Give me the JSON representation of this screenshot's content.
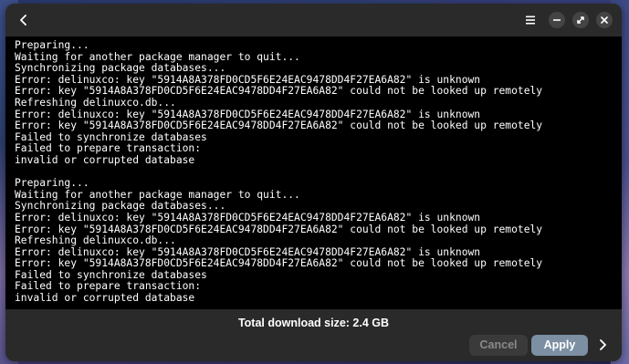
{
  "colors": {
    "window_bg": "#1e1e1e",
    "headerbar_bg": "#2a2a2a",
    "terminal_bg": "#000000",
    "terminal_text": "#ffffff",
    "apply_bg": "#7c8fa3",
    "cancel_bg": "#3a3a3a"
  },
  "header": {
    "back_icon": "chevron-left",
    "menu_icon": "hamburger-menu",
    "minimize_icon": "minimize",
    "maximize_icon": "maximize",
    "close_icon": "close"
  },
  "terminal": {
    "lines": [
      "Preparing...",
      "Waiting for another package manager to quit...",
      "Synchronizing package databases...",
      "Error: delinuxco: key \"5914A8A378FD0CD5F6E24EAC9478DD4F27EA6A82\" is unknown",
      "Error: key \"5914A8A378FD0CD5F6E24EAC9478DD4F27EA6A82\" could not be looked up remotely",
      "Refreshing delinuxco.db...",
      "Error: delinuxco: key \"5914A8A378FD0CD5F6E24EAC9478DD4F27EA6A82\" is unknown",
      "Error: key \"5914A8A378FD0CD5F6E24EAC9478DD4F27EA6A82\" could not be looked up remotely",
      "Failed to synchronize databases",
      "Failed to prepare transaction:",
      "invalid or corrupted database",
      "",
      "Preparing...",
      "Waiting for another package manager to quit...",
      "Synchronizing package databases...",
      "Error: delinuxco: key \"5914A8A378FD0CD5F6E24EAC9478DD4F27EA6A82\" is unknown",
      "Error: key \"5914A8A378FD0CD5F6E24EAC9478DD4F27EA6A82\" could not be looked up remotely",
      "Refreshing delinuxco.db...",
      "Error: delinuxco: key \"5914A8A378FD0CD5F6E24EAC9478DD4F27EA6A82\" is unknown",
      "Error: key \"5914A8A378FD0CD5F6E24EAC9478DD4F27EA6A82\" could not be looked up remotely",
      "Failed to synchronize databases",
      "Failed to prepare transaction:",
      "invalid or corrupted database"
    ]
  },
  "footer": {
    "total_label": "Total download size: 2.4 GB",
    "cancel_label": "Cancel",
    "apply_label": "Apply",
    "next_icon": "chevron-right"
  }
}
